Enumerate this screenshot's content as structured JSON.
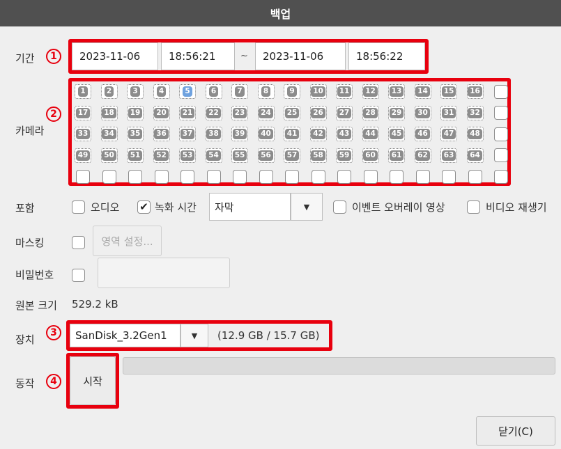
{
  "window": {
    "title": "백업"
  },
  "period": {
    "label": "기간",
    "start_date": "2023-11-06",
    "start_time": "18:56:21",
    "separator": "~",
    "end_date": "2023-11-06",
    "end_time": "18:56:22"
  },
  "camera": {
    "label": "카메라",
    "selected": 5,
    "rows": [
      [
        "1",
        "2",
        "3",
        "4",
        "5",
        "6",
        "7",
        "8",
        "9",
        "10",
        "11",
        "12",
        "13",
        "14",
        "15",
        "16"
      ],
      [
        "17",
        "18",
        "19",
        "20",
        "21",
        "22",
        "23",
        "24",
        "25",
        "26",
        "27",
        "28",
        "29",
        "30",
        "31",
        "32"
      ],
      [
        "33",
        "34",
        "35",
        "36",
        "37",
        "38",
        "39",
        "40",
        "41",
        "42",
        "43",
        "44",
        "45",
        "46",
        "47",
        "48"
      ],
      [
        "49",
        "50",
        "51",
        "52",
        "53",
        "54",
        "55",
        "56",
        "57",
        "58",
        "59",
        "60",
        "61",
        "62",
        "63",
        "64"
      ]
    ]
  },
  "include": {
    "label": "포함",
    "audio_label": "오디오",
    "audio_checked": false,
    "rec_time_label": "녹화 시간",
    "rec_time_checked": true,
    "rec_time_mode": "자막",
    "event_overlay_label": "이벤트 오버레이 영상",
    "event_overlay_checked": false,
    "video_player_label": "비디오 재생기",
    "video_player_checked": false
  },
  "masking": {
    "label": "마스킹",
    "area_button": "영역 설정..."
  },
  "password": {
    "label": "비밀번호"
  },
  "original_size": {
    "label": "원본 크기",
    "value": "529.2 kB"
  },
  "device": {
    "label": "장치",
    "name": "SanDisk_3.2Gen1",
    "capacity": "(12.9 GB / 15.7 GB)"
  },
  "action": {
    "label": "동작",
    "start_button": "시작",
    "progress": 0
  },
  "close_button": "닫기(C)",
  "annotations": {
    "b1": "1",
    "b2": "2",
    "b3": "3",
    "b4": "4"
  }
}
